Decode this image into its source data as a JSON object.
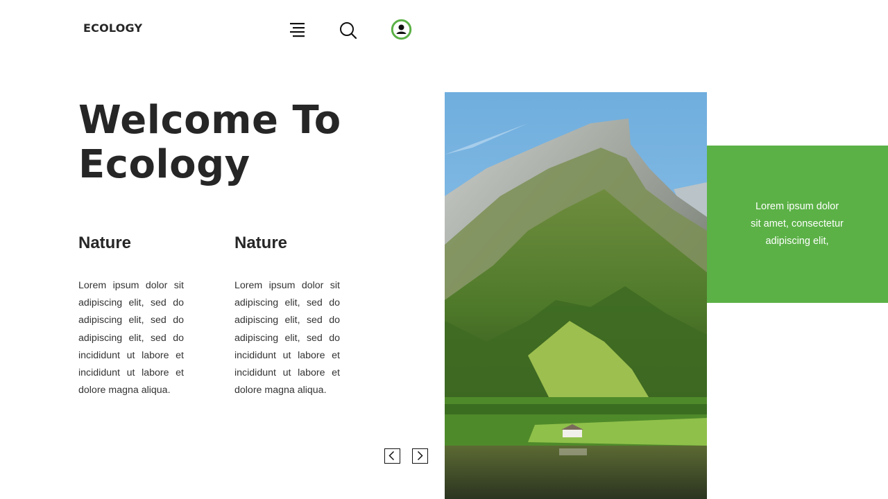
{
  "header": {
    "brand": "ECOLOGY",
    "icons": [
      "menu-icon",
      "search-icon",
      "user-icon"
    ],
    "accent_color": "#5bb146"
  },
  "hero": {
    "title_line1": "Welcome To",
    "title_line2": "Ecology"
  },
  "columns": [
    {
      "heading": "Nature",
      "body": "Lorem ipsum dolor sit adipiscing elit, sed do adipiscing elit, sed do adipiscing elit, sed do incididunt ut labore et incididunt ut labore et dolore magna aliqua."
    },
    {
      "heading": "Nature",
      "body": "Lorem ipsum dolor sit adipiscing elit, sed do adipiscing elit, sed do adipiscing elit, sed do incididunt ut labore et incididunt ut labore et dolore magna aliqua."
    }
  ],
  "pager": {
    "icons": [
      "chevron-left-icon",
      "chevron-right-icon"
    ]
  },
  "feature_image": {
    "subject": "mountain-lake-landscape"
  },
  "green_panel": {
    "line1": "Lorem ipsum dolor",
    "line2": "sit amet, consectetur",
    "line3": "adipiscing elit,",
    "color": "#5bb146"
  }
}
